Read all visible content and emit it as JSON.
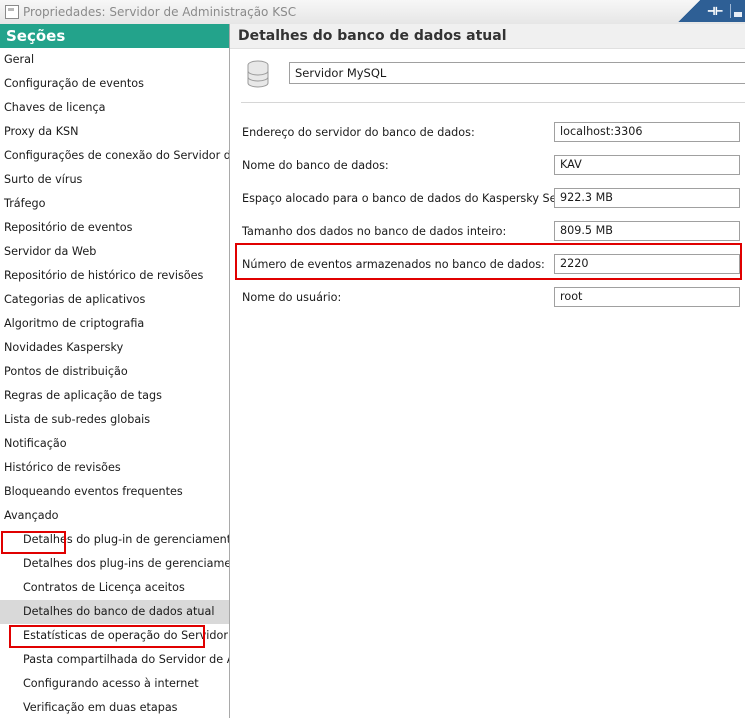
{
  "window": {
    "title": "Propriedades: Servidor de Administração KSC"
  },
  "sidebar": {
    "header": "Seções",
    "items": [
      {
        "label": "Geral"
      },
      {
        "label": "Configuração de eventos"
      },
      {
        "label": "Chaves de licença"
      },
      {
        "label": "Proxy da KSN"
      },
      {
        "label": "Configurações de conexão do Servidor de Adm"
      },
      {
        "label": "Surto de vírus"
      },
      {
        "label": "Tráfego"
      },
      {
        "label": "Repositório de eventos"
      },
      {
        "label": "Servidor da Web"
      },
      {
        "label": "Repositório de histórico de revisões"
      },
      {
        "label": "Categorias de aplicativos"
      },
      {
        "label": "Algoritmo de criptografia"
      },
      {
        "label": "Novidades Kaspersky"
      },
      {
        "label": "Pontos de distribuição"
      },
      {
        "label": "Regras de aplicação de tags"
      },
      {
        "label": "Lista de sub-redes globais"
      },
      {
        "label": "Notificação"
      },
      {
        "label": "Histórico de revisões"
      },
      {
        "label": "Bloqueando eventos frequentes"
      },
      {
        "label": "Avançado"
      }
    ],
    "sub_items": [
      {
        "label": "Detalhes do plug-in de gerenciamento do S"
      },
      {
        "label": "Detalhes dos plug-ins de gerenciamento de"
      },
      {
        "label": "Contratos de Licença aceitos"
      },
      {
        "label": "Detalhes do banco de dados atual"
      },
      {
        "label": "Estatísticas de operação do Servidor de Ad"
      },
      {
        "label": "Pasta compartilhada do Servidor de Admini"
      },
      {
        "label": "Configurando acesso à internet"
      },
      {
        "label": "Verificação em duas etapas"
      }
    ]
  },
  "main": {
    "title": "Detalhes do banco de dados atual",
    "server_type": "Servidor MySQL",
    "fields": [
      {
        "label": "Endereço do servidor do banco de dados:",
        "value": "localhost:3306"
      },
      {
        "label": "Nome do banco de dados:",
        "value": "KAV"
      },
      {
        "label": "Espaço alocado para o banco de dados do Kaspersky Security",
        "value": "922.3 MB"
      },
      {
        "label": "Tamanho dos dados no banco de dados inteiro:",
        "value": "809.5 MB"
      },
      {
        "label": "Número de eventos armazenados no banco de dados:",
        "value": "2220"
      },
      {
        "label": "Nome do usuário:",
        "value": "root"
      }
    ]
  },
  "colors": {
    "sidebar_header": "#23a38b",
    "highlight": "#e00000",
    "selected_item": "#d9d9d9"
  }
}
